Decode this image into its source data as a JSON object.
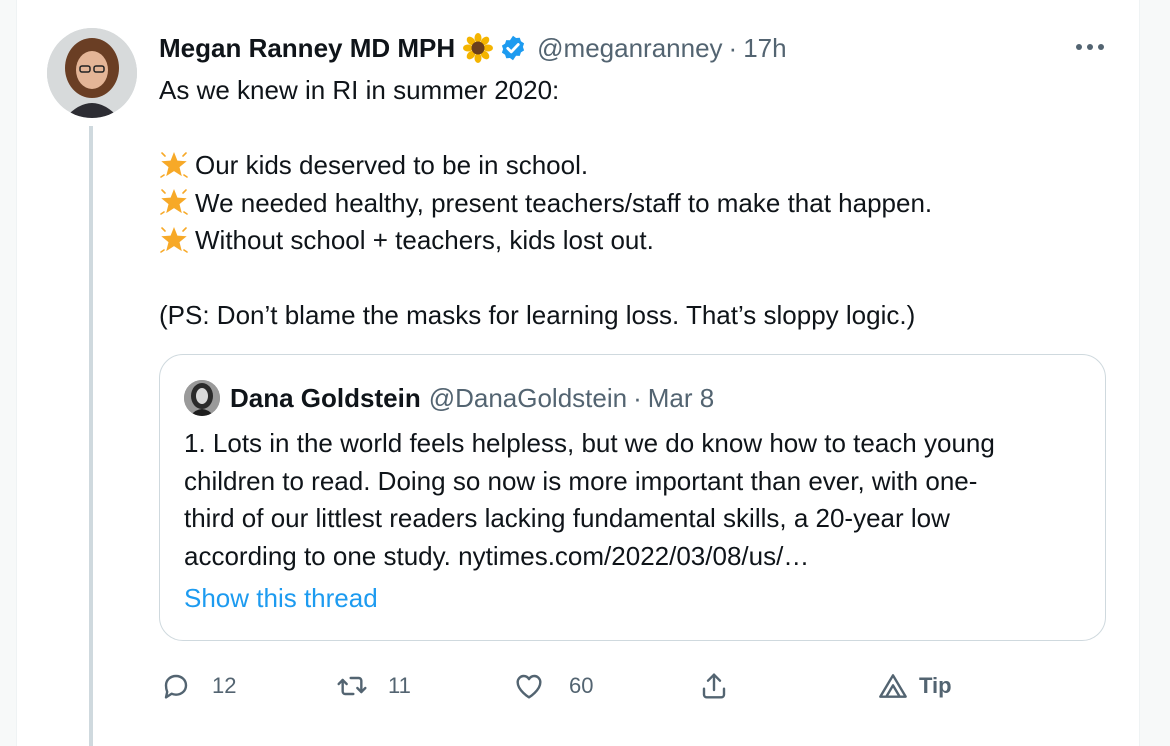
{
  "tweet": {
    "author_name": "Megan Ranney MD MPH",
    "author_emoji": "sunflower-emoji",
    "verified_icon": "verified-badge-icon",
    "handle": "@meganranney",
    "separator": "·",
    "time": "17h",
    "lines": [
      "As we knew in RI in summer 2020:",
      "",
      "Our kids deserved to be in school.",
      "We needed healthy, present teachers/staff to make that happen.",
      "Without school + teachers, kids lost out.",
      "",
      "(PS: Don’t blame the masks for learning loss. That’s sloppy logic.)"
    ]
  },
  "quoted": {
    "author_name": "Dana Goldstein",
    "handle": "@DanaGoldstein",
    "separator": "·",
    "time": "Mar 8",
    "lines": [
      "1. Lots in the world feels helpless, but we do know how to teach young",
      "children to read. Doing so now is more important than ever, with one-",
      "third of our littlest readers lacking fundamental skills, a 20-year low",
      "according to one study. nytimes.com/2022/03/08/us/…"
    ],
    "show_thread": "Show this thread"
  },
  "actions": {
    "reply_count": "12",
    "retweet_count": "11",
    "like_count": "60",
    "tip_label": "Tip"
  },
  "colors": {
    "accent": "#1d9bf0",
    "text": "#0f1419",
    "secondary": "#536471",
    "border": "#cfd9de"
  }
}
